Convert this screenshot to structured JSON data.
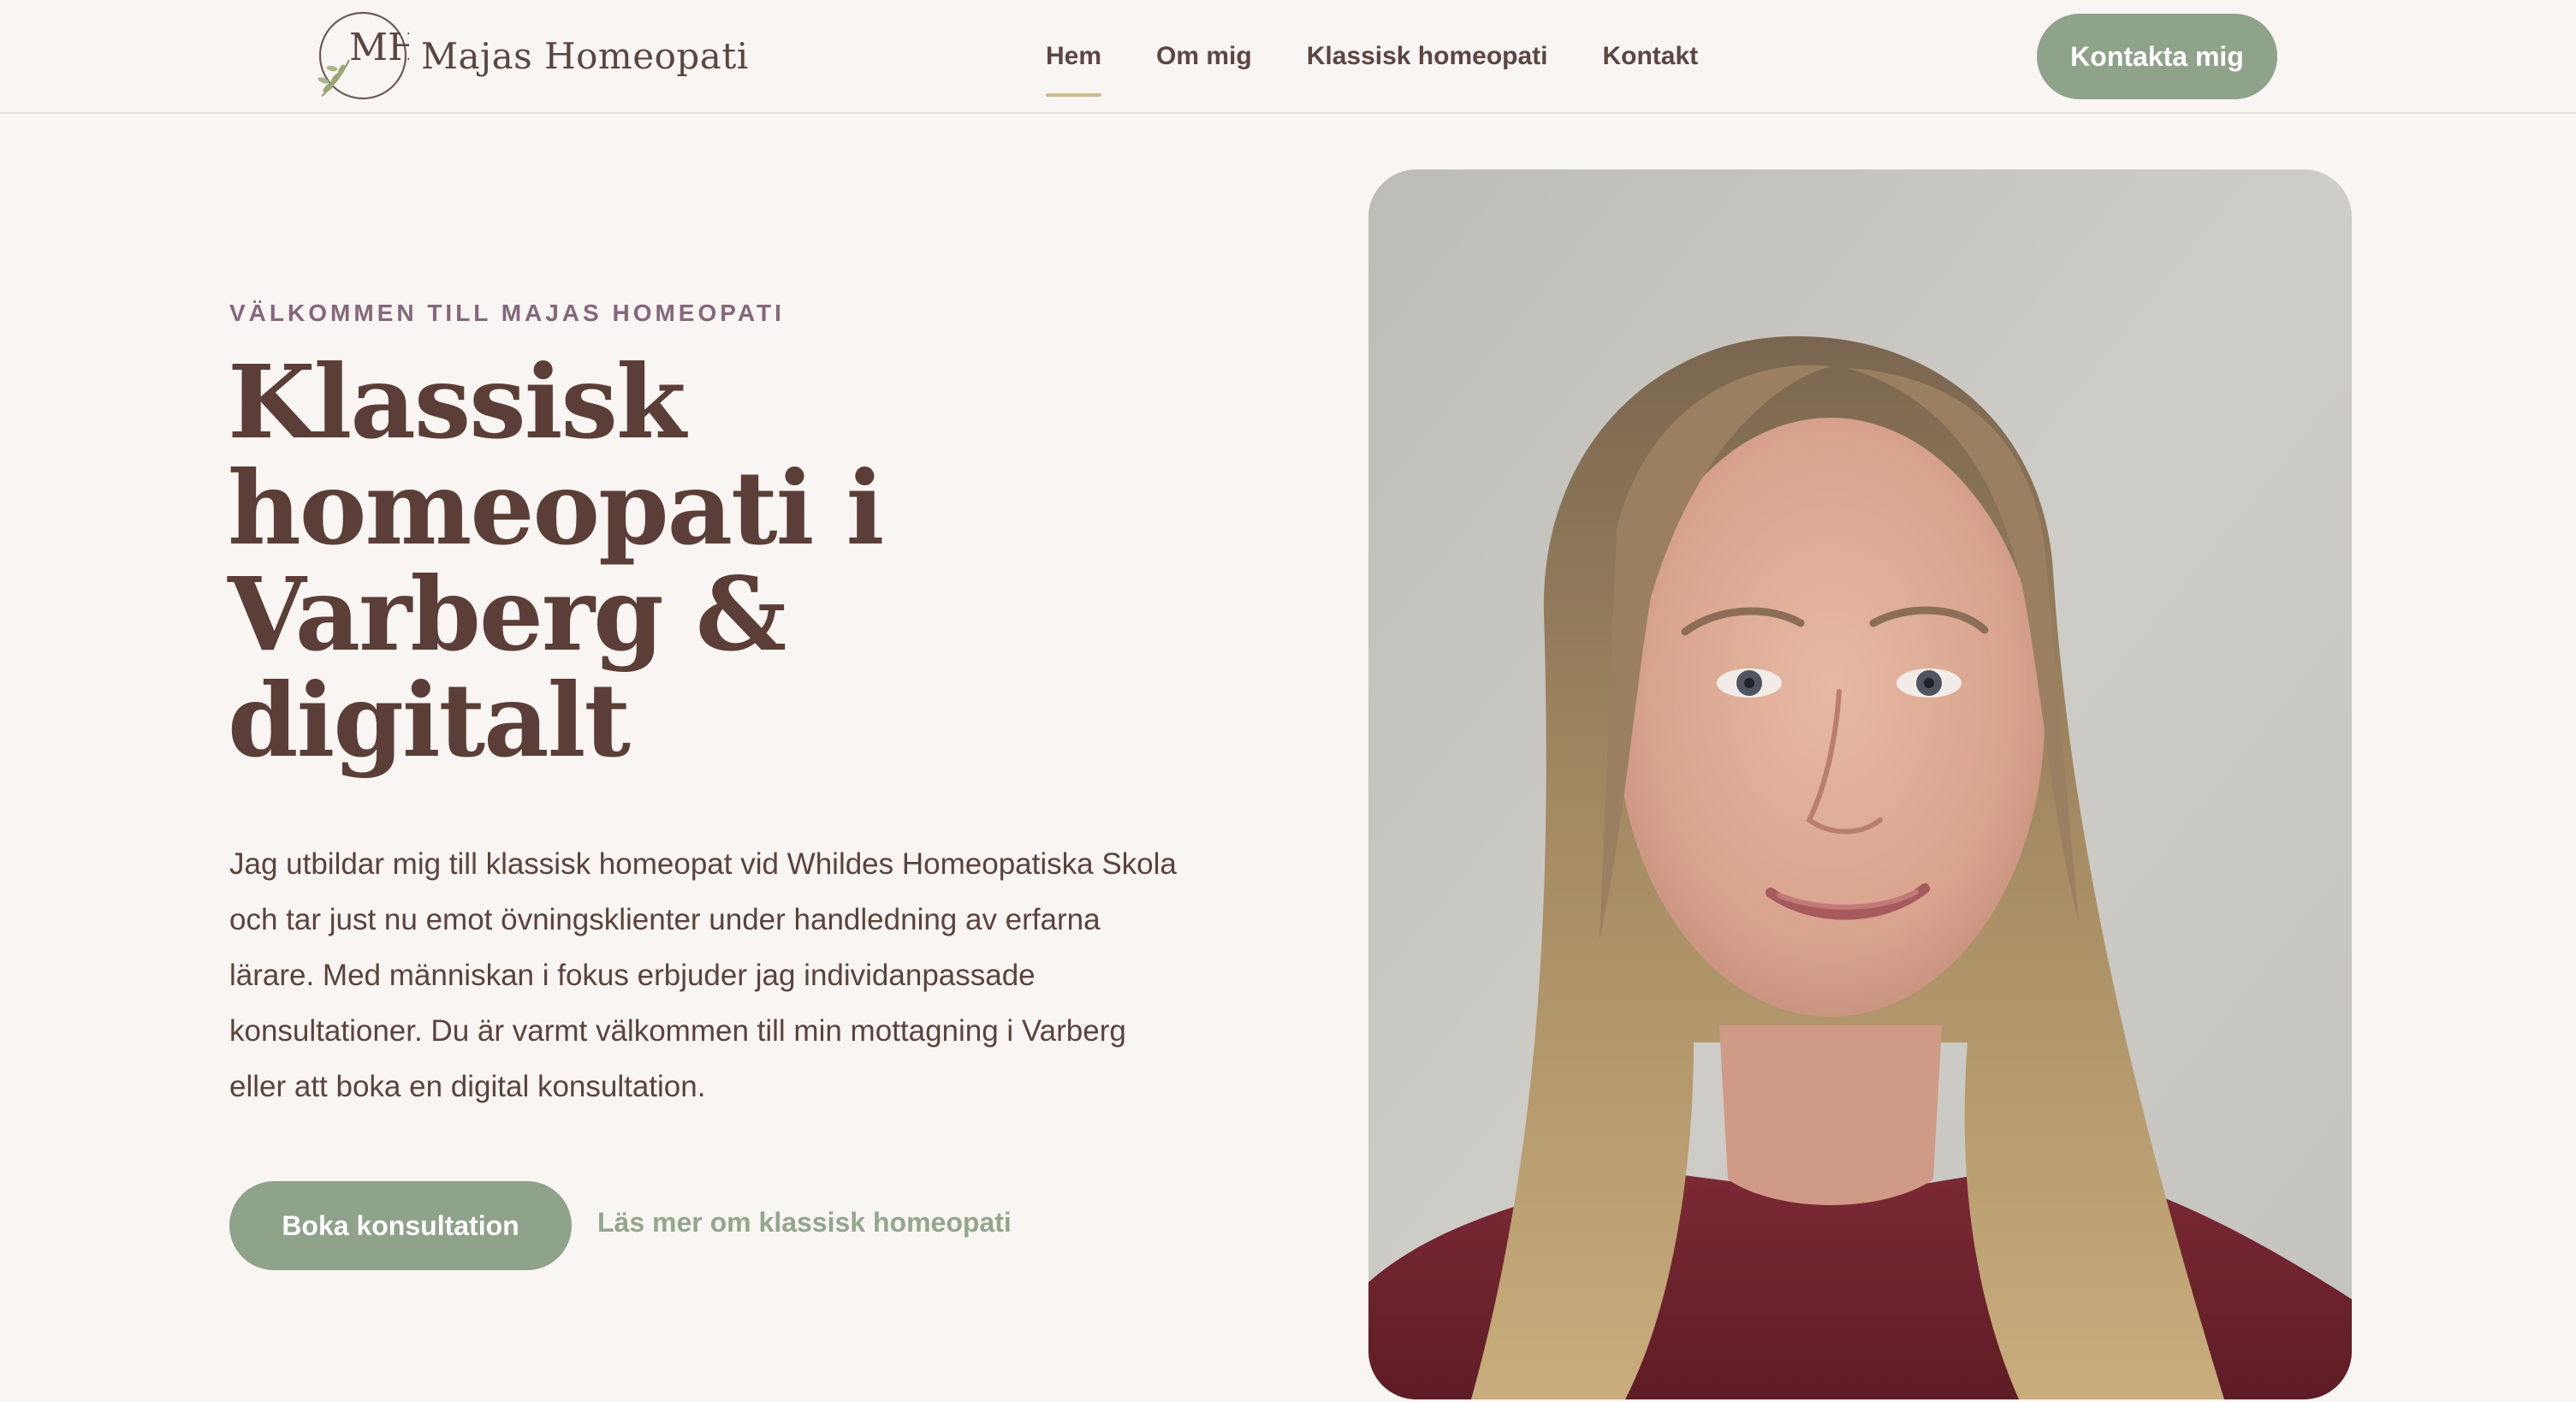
{
  "header": {
    "brand": {
      "monogram": "MH",
      "name": "Majas Homeopati"
    },
    "nav": [
      {
        "label": "Hem",
        "active": true
      },
      {
        "label": "Om mig",
        "active": false
      },
      {
        "label": "Klassisk homeopati",
        "active": false
      },
      {
        "label": "Kontakt",
        "active": false
      }
    ],
    "cta_label": "Kontakta mig"
  },
  "hero": {
    "eyebrow": "VÄLKOMMEN TILL MAJAS HOMEOPATI",
    "title_lines": [
      "Klassisk",
      "homeopati i",
      "Varberg &",
      "digitalt"
    ],
    "body_lines": [
      "Jag utbildar mig till klassisk homeopat vid Whildes Homeopatiska Skola",
      "och tar just nu emot övningsklienter under handledning av erfarna",
      "lärare. Med människan i fokus erbjuder jag individanpassade",
      "konsultationer. Du är varmt välkommen till min mottagning i Varberg",
      "eller att boka en digital konsultation."
    ],
    "primary_button": "Boka konsultation",
    "secondary_link": "Läs mer om klassisk homeopati",
    "portrait": {
      "subject": "portrait of a smiling woman with long blonde hair wearing a dark red top",
      "icon": "person-portrait"
    }
  },
  "colors": {
    "background": "#f9f5f2",
    "accent_green": "#8fa28a",
    "heading_brown": "#5b3e37",
    "eyebrow_purple": "#84677d",
    "nav_underline": "#cbbd8c"
  }
}
